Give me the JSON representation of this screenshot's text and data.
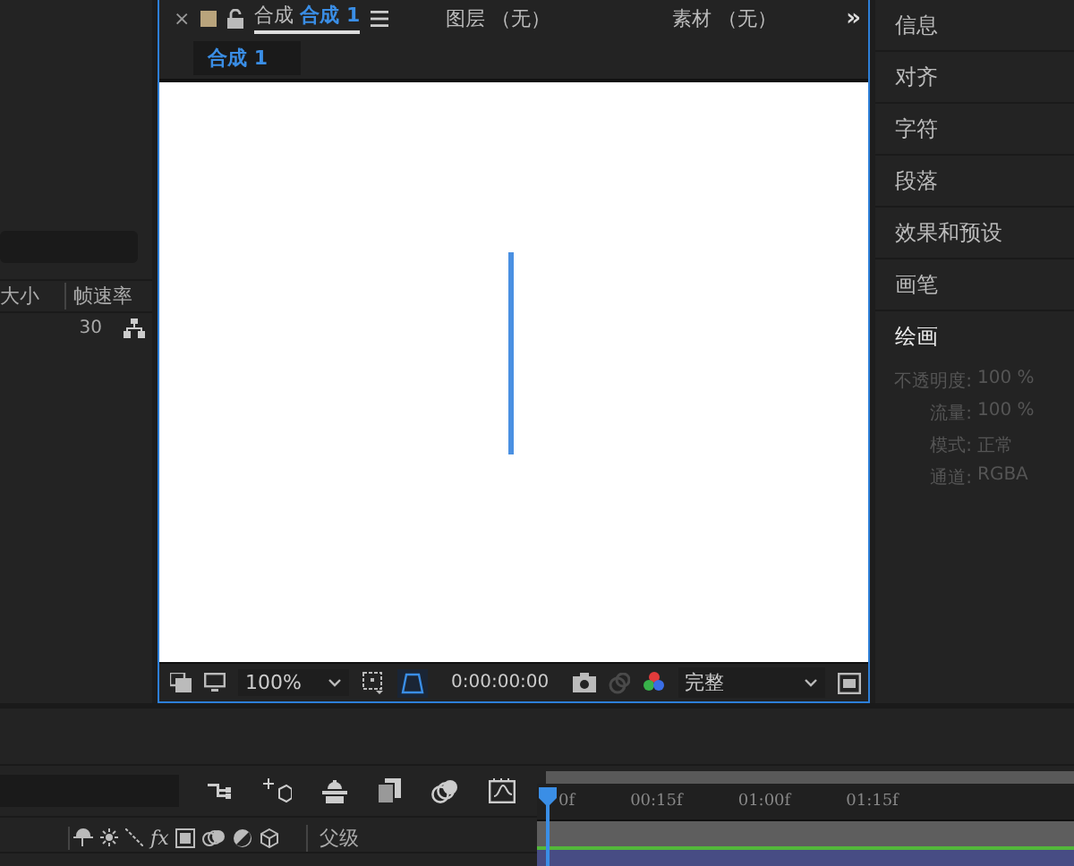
{
  "left_panel": {
    "columns": [
      {
        "label": "大小"
      },
      {
        "label": "帧速率"
      }
    ],
    "rows": [
      {
        "frame_rate": "30"
      }
    ]
  },
  "composition_panel": {
    "tabs": [
      {
        "kind": "comp",
        "prefix": "合成",
        "label": "合成 1",
        "selected": true
      },
      {
        "kind": "plain",
        "label": "图层 （无）",
        "selected": false
      },
      {
        "kind": "plain",
        "label": "素材 （无）",
        "selected": false
      }
    ],
    "close": "×",
    "overflow": "»",
    "breadcrumb": "合成 1",
    "toolbar": {
      "zoom": "100%",
      "timecode": "0:00:00:00",
      "resolution": "完整"
    }
  },
  "right_panel": {
    "items": [
      {
        "label": "信息",
        "expanded": false
      },
      {
        "label": "对齐",
        "expanded": false
      },
      {
        "label": "字符",
        "expanded": false
      },
      {
        "label": "段落",
        "expanded": false
      },
      {
        "label": "效果和预设",
        "expanded": false
      },
      {
        "label": "画笔",
        "expanded": false
      },
      {
        "label": "绘画",
        "expanded": true
      }
    ],
    "paint_settings": [
      {
        "label": "不透明度:",
        "value": "100 %",
        "disabled": true
      },
      {
        "label": "流量:",
        "value": "100 %",
        "disabled": true
      },
      {
        "label": "模式:",
        "value": "正常",
        "disabled": true
      },
      {
        "label": "通道:",
        "value": "RGBA",
        "disabled": true
      }
    ]
  },
  "timeline": {
    "ruler": [
      "0f",
      "00:15f",
      "01:00f",
      "01:15f"
    ],
    "effects_toggle": "fx",
    "columns": [
      {
        "label": "父级"
      }
    ]
  }
}
